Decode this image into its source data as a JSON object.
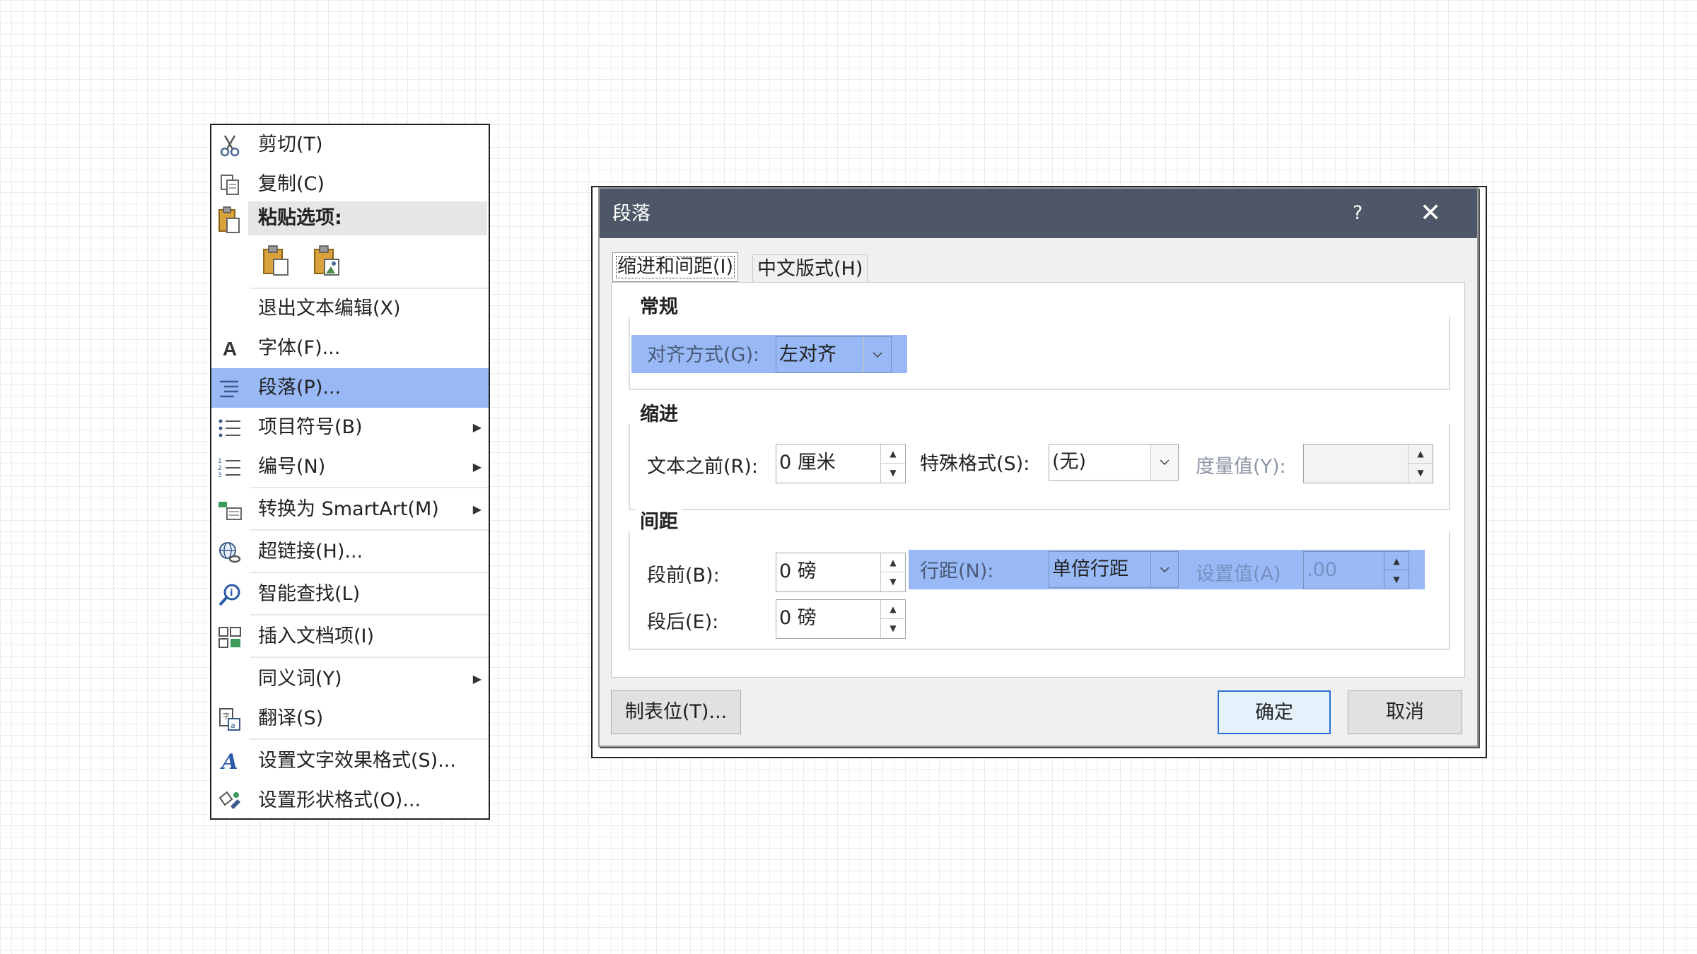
{
  "context_menu": {
    "items": [
      {
        "label": "剪切(T)",
        "icon": "scissors-icon"
      },
      {
        "label": "复制(C)",
        "icon": "copy-icon"
      },
      {
        "label": "粘贴选项:",
        "icon": "clipboard-icon"
      },
      {
        "label": "退出文本编辑(X)"
      },
      {
        "label": "字体(F)...",
        "icon": "font-icon"
      },
      {
        "label": "段落(P)...",
        "icon": "paragraph-icon"
      },
      {
        "label": "项目符号(B)",
        "icon": "bullets-icon"
      },
      {
        "label": "编号(N)",
        "icon": "numbering-icon"
      },
      {
        "label": "转换为 SmartArt(M)",
        "icon": "smartart-icon"
      },
      {
        "label": "超链接(H)...",
        "icon": "hyperlink-icon"
      },
      {
        "label": "智能查找(L)",
        "icon": "smart-lookup-icon"
      },
      {
        "label": "插入文档项(I)",
        "icon": "document-item-icon"
      },
      {
        "label": "同义词(Y)"
      },
      {
        "label": "翻译(S)",
        "icon": "translate-icon"
      },
      {
        "label": "设置文字效果格式(S)...",
        "icon": "text-effects-icon"
      },
      {
        "label": "设置形状格式(O)...",
        "icon": "shape-format-icon"
      }
    ],
    "selected_item": "段落(P)...",
    "selection_color": "#98b9f6"
  },
  "dialog": {
    "title": "段落",
    "help": "?",
    "close": "✕",
    "tabs": [
      "缩进和间距(I)",
      "中文版式(H)"
    ],
    "general": {
      "title": "常规",
      "alignment_label": "对齐方式(G):",
      "alignment_value": "左对齐"
    },
    "indent": {
      "title": "缩进",
      "before_text_label": "文本之前(R):",
      "before_text_value": "0 厘米",
      "special_label": "特殊格式(S):",
      "special_value": "(无)",
      "by_label": "度量值(Y):",
      "by_value": ""
    },
    "spacing": {
      "title": "间距",
      "before_label": "段前(B):",
      "before_value": "0 磅",
      "after_label": "段后(E):",
      "after_value": "0 磅",
      "line_label": "行距(N):",
      "line_value": "单倍行距",
      "at_label": "设置值(A)",
      "at_value": ".00"
    },
    "buttons": {
      "tabs": "制表位(T)...",
      "ok": "确定",
      "cancel": "取消"
    }
  }
}
